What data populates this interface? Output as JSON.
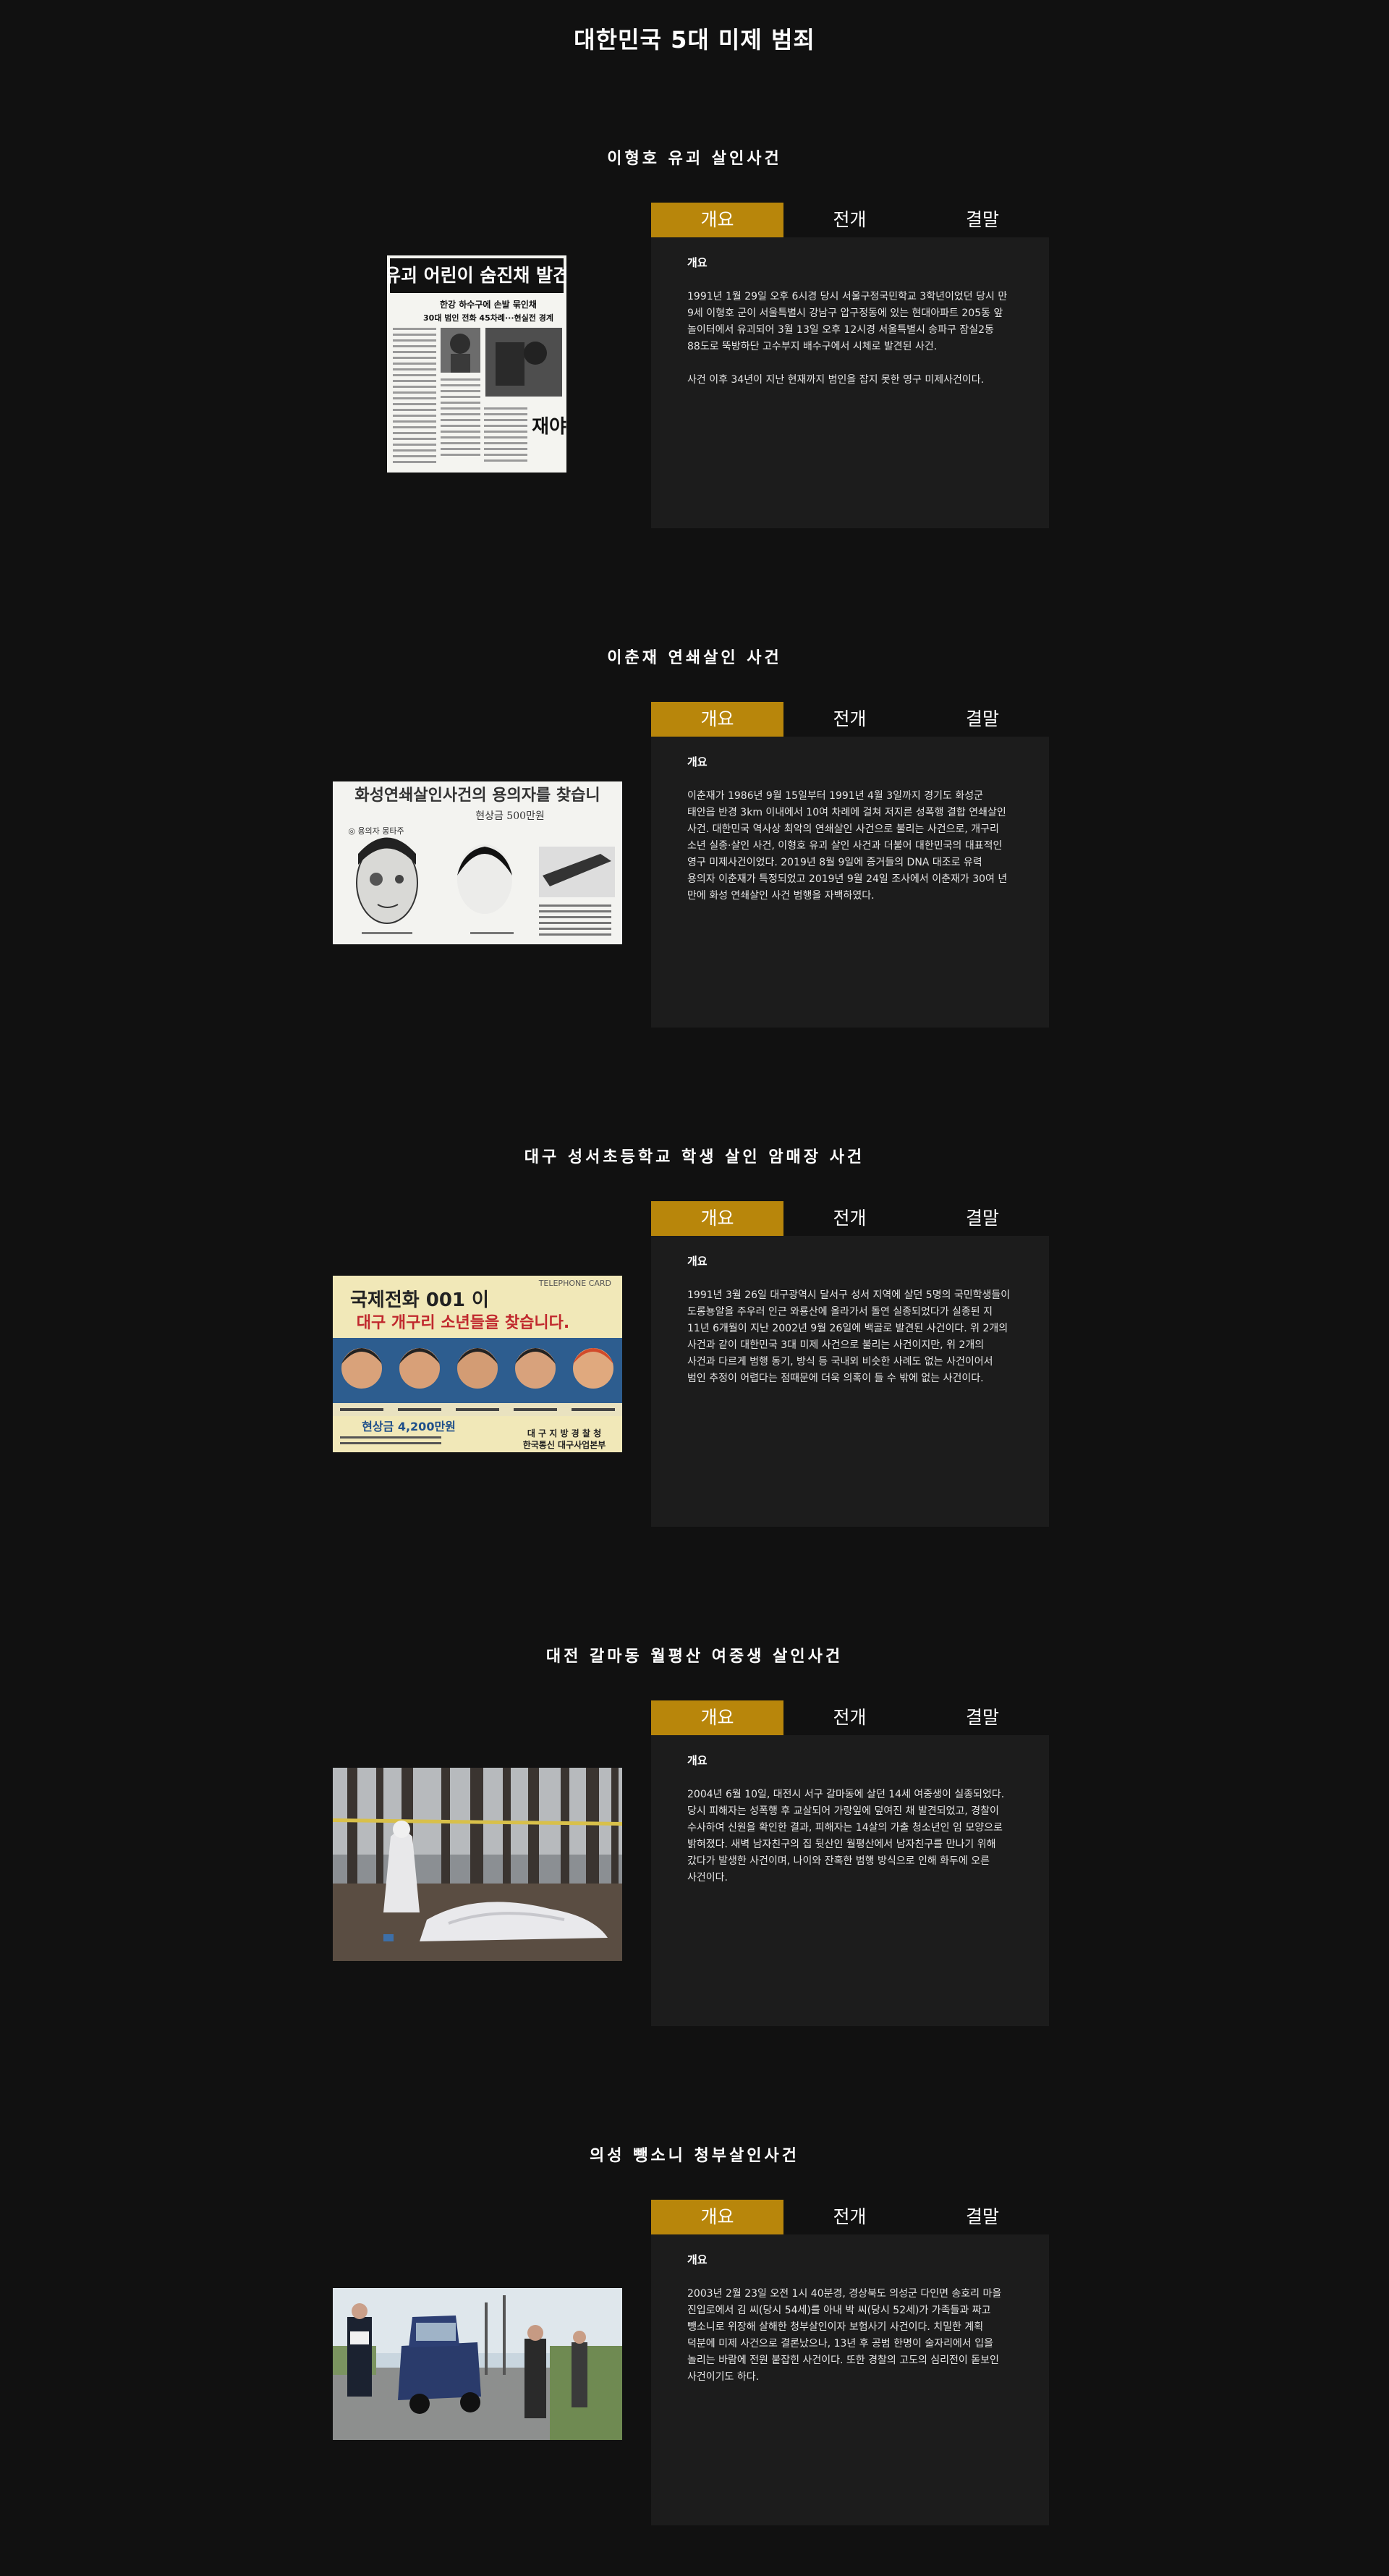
{
  "page": {
    "title": "대한민국 5대 미제 범죄"
  },
  "tabs": [
    "개요",
    "전개",
    "결말"
  ],
  "colors": {
    "background": "#111111",
    "panel": "#1c1c1c",
    "active_tab": "#b8860b"
  },
  "cases": [
    {
      "title": "이형호 유괴 살인사건",
      "heading": "개요",
      "paragraphs": [
        "1991년 1월 29일 오후 6시경 당시 서울구정국민학교 3학년이었던 당시 만 9세 이형호 군이 서울특별시 강남구 압구정동에 있는 현대아파트 205동 앞 놀이터에서 유괴되어 3월 13일 오후 12시경 서울특별시 송파구 잠실2동 88도로 뚝방하단 고수부지 배수구에서 시체로 발견된 사건.",
        "사건 이후 34년이 지난 현재까지 범인을 잡지 못한 영구 미제사건이다."
      ],
      "image": {
        "headline": "유괴 어린이 숨진채 발견",
        "sub1": "한강 하수구에 손발 묶인채",
        "sub2": "30대 범인 전화 45차례···현실전 경계",
        "side": "재야"
      }
    },
    {
      "title": "이춘재 연쇄살인 사건",
      "heading": "개요",
      "paragraphs": [
        "이춘재가 1986년 9월 15일부터 1991년 4월 3일까지 경기도 화성군 태안읍 반경 3km 이내에서 10여 차례에 걸쳐 저지른 성폭행 결합 연쇄살인 사건. 대한민국 역사상 최악의 연쇄살인 사건으로 불리는 사건으로, 개구리 소년 실종·살인 사건, 이형호 유괴 살인 사건과 더불어 대한민국의 대표적인 영구 미제사건이었다. 2019년 8월 9일에 증거들의 DNA 대조로 유력 용의자 이춘재가 특정되었고 2019년 9월 24일 조사에서 이춘재가 30여 년 만에 화성 연쇄살인 사건 범행을 자백하였다."
      ],
      "image": {
        "headline": "화성연쇄살인사건의 용의자를 찾습니",
        "reward": "현상금 500만원",
        "label": "◎ 용의자 몽타주"
      }
    },
    {
      "title": "대구 성서초등학교 학생 살인 암매장 사건",
      "heading": "개요",
      "paragraphs": [
        "1991년 3월 26일 대구광역시 달서구 성서 지역에 살던 5명의 국민학생들이 도롱뇽알을 주우러 인근 와룡산에 올라가서 돌연 실종되었다가 실종된 지 11년 6개월이 지난 2002년 9월 26일에 백골로 발견된 사건이다. 위 2개의 사건과 같이 대한민국 3대 미제 사건으로 불리는 사건이지만, 위 2개의 사건과 다르게 범행 동기, 방식 등 국내외 비슷한 사례도 없는 사건이어서 범인 추정이 어렵다는 점때문에 더욱 의혹이 들 수 밖에 없는 사건이다."
      ],
      "image": {
        "telephone": "TELEPHONE CARD",
        "headline1": "국제전화 001 이",
        "headline2": "대구 개구리 소년들을 찾습니다.",
        "reward": "현상금 4,200만원",
        "org1": "대 구 지 방 경 찰 청",
        "org2": "한국통신 대구사업본부"
      }
    },
    {
      "title": "대전 갈마동 월평산 여중생 살인사건",
      "heading": "개요",
      "paragraphs": [
        "2004년 6월 10일, 대전시 서구 갈마동에 살던 14세 여중생이 실종되었다. 당시 피해자는 성폭행 후 교살되어 가랑잎에 덮여진 채 발견되었고, 경찰이 수사하여 신원을 확인한 결과, 피해자는 14살의 가출 청소년인 임 모양으로 밝혀졌다. 새벽 남자친구의 집 뒷산인 월평산에서 남자친구를 만나기 위해 갔다가 발생한 사건이며, 나이와 잔혹한 범행 방식으로 인해 화두에 오른 사건이다."
      ],
      "image": {}
    },
    {
      "title": "의성 뺑소니 청부살인사건",
      "heading": "개요",
      "paragraphs": [
        "2003년 2월 23일 오전 1시 40분경, 경상북도 의성군 다인면 송호리 마을 진입로에서 김 씨(당시 54세)를 아내 박 씨(당시 52세)가 가족들과 짜고 뺑소니로 위장해 살해한 청부살인이자 보험사기 사건이다. 치밀한 계획 덕분에 미제 사건으로 결론났으나, 13년 후 공범 한명이 술자리에서 입을 놀리는 바람에 전원 붙잡힌 사건이다. 또한 경찰의 고도의 심리전이 돋보인 사건이기도 하다."
      ],
      "image": {}
    }
  ]
}
